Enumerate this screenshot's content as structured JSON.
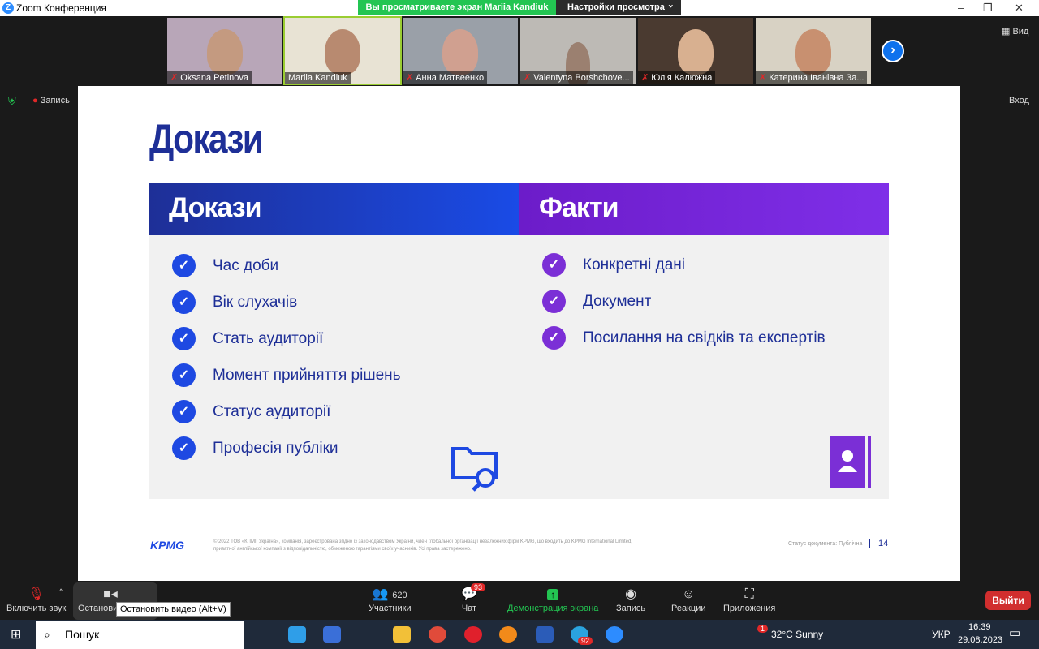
{
  "window": {
    "title": "Zoom Конференция",
    "minimize": "–",
    "restore": "❐",
    "close": "✕"
  },
  "banner": {
    "sharing": "Вы просматриваете экран Mariia Kandiuk",
    "view_settings": "Настройки просмотра",
    "chevron": "⌄"
  },
  "participants": [
    {
      "name": "Oksana Petinova",
      "muted": true
    },
    {
      "name": "Mariia Kandiuk",
      "muted": false
    },
    {
      "name": "Анна Матвеенко",
      "muted": true
    },
    {
      "name": "Valentyna Borshchove...",
      "muted": true
    },
    {
      "name": "Юлія Калюжна",
      "muted": true
    },
    {
      "name": "Катерина Іванівна За...",
      "muted": true
    }
  ],
  "side": {
    "view": "Вид",
    "recording": "Запись",
    "exit_fullscreen": "Вход"
  },
  "slide": {
    "title": "Докази",
    "left": {
      "header": "Докази",
      "items": [
        "Час доби",
        "Вік слухачів",
        "Стать аудиторії",
        "Момент прийняття рішень",
        "Статус аудиторії",
        "Професія публіки"
      ]
    },
    "right": {
      "header": "Факти",
      "items": [
        "Конкретні дані",
        "Документ",
        "Посилання на свідків та експертів"
      ]
    },
    "footer": {
      "logo": "KPMG",
      "legal": "© 2022 ТОВ «КПМГ Україна», компанія, зареєстрована згідно із законодавством України, член глобальної організації незалежних фірм KPMG, що входить до KPMG International Limited, приватної англійської компанії з відповідальністю, обмеженою гарантіями своїх учасників. Усі права застережено.",
      "status": "Статус документа: Публічна",
      "page": "14"
    }
  },
  "toolbar": {
    "unmute": "Включить звук",
    "stop_video": "Остановить видео",
    "participants": "Участники",
    "participants_count": "620",
    "chat": "Чат",
    "chat_badge": "93",
    "share": "Демонстрация экрана",
    "record": "Запись",
    "reactions": "Реакции",
    "apps": "Приложения",
    "leave": "Выйти",
    "tooltip": "Остановить видео (Alt+V)"
  },
  "taskbar": {
    "search": "Пошук",
    "weather": "32°C  Sunny",
    "lang": "УКР",
    "time": "16:39",
    "date": "29.08.2023",
    "telegram_badge": "92",
    "weather_badge": "1"
  },
  "colors": {
    "navy": "#1e2f97",
    "blue": "#1e49e2",
    "purple": "#7b2fd6",
    "zoom_green": "#23c552",
    "leave_red": "#d12e2e"
  }
}
